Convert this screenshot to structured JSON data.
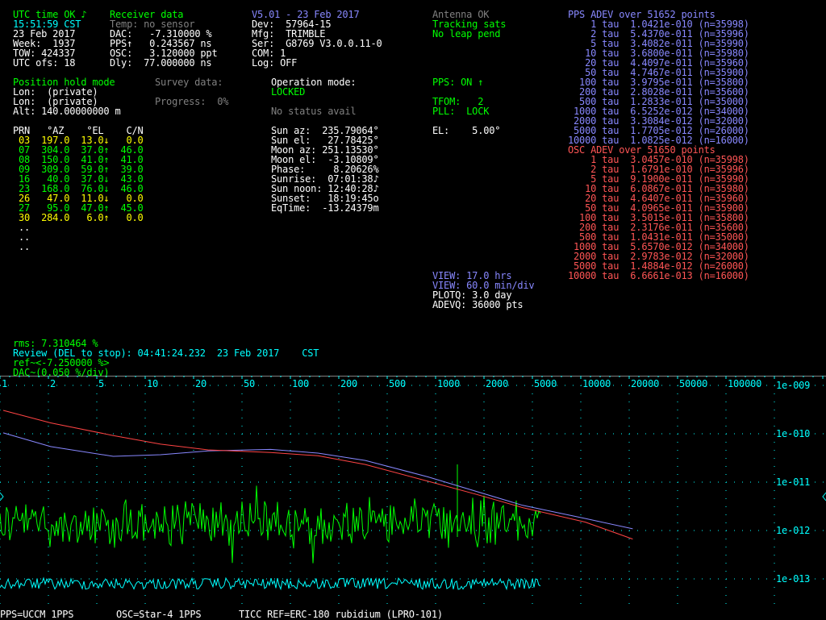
{
  "receiver": {
    "utc_status": "UTC time OK ♪",
    "time": "15:51:59 CST",
    "date": "23 Feb 2017",
    "week": "Week:  1937",
    "tow": "TOW: 424337",
    "utc_ofs": "UTC ofs: 18",
    "title": "Receiver data",
    "temp": "Temp: no sensor",
    "dac": "DAC:   -7.310000 %",
    "pps": "PPS↑   0.243567 ns",
    "osc": "OSC:   3.120000 ppt",
    "dly": "Dly:  77.000000 ns"
  },
  "device": {
    "version": "V5.01 - 23 Feb 2017",
    "dev": "Dev:  57964-15",
    "mfg": "Mfg:  TRIMBLE",
    "ser": "Ser:  G8769 V3.0.0.11-0",
    "com": "COM: 1",
    "log": "Log: OFF"
  },
  "antenna": {
    "antenna": "Antenna OK",
    "tracking": "Tracking sats",
    "leap": "No leap pend"
  },
  "position": {
    "mode": "Position hold mode",
    "lat": "Lon:  (private)",
    "lon": "Lon:  (private)",
    "alt": "Alt: 140.00000000 m",
    "survey": "Survey data:",
    "progress": "Progress:  0%"
  },
  "operation": {
    "label": "Operation mode:",
    "mode": "LOCKED",
    "status": "No status avail"
  },
  "pps_status": {
    "pps": "PPS: ON ↑",
    "tfom": "TFOM:   2",
    "pll": "PLL:  LOCK",
    "el": "EL:    5.00°"
  },
  "sats": {
    "header": "PRN   °AZ    °EL    C/N",
    "rows": [
      {
        "text": " 03  197.0  13.0↓   0.0",
        "color": "#ffff00"
      },
      {
        "text": " 07  304.0  37.0↑  46.0",
        "color": "#00ff00"
      },
      {
        "text": " 08  150.0  41.0↑  41.0",
        "color": "#00ff00"
      },
      {
        "text": " 09  309.0  59.0↑  39.0",
        "color": "#00ff00"
      },
      {
        "text": " 16   40.0  37.0↓  43.0",
        "color": "#00ff00"
      },
      {
        "text": " 23  168.0  76.0↓  46.0",
        "color": "#00ff00"
      },
      {
        "text": " 26   47.0  11.0↓   0.0",
        "color": "#ffff00"
      },
      {
        "text": " 27   95.0  47.0↑  45.0",
        "color": "#00ff00"
      },
      {
        "text": " 30  284.0   6.0↑   0.0",
        "color": "#ffff00"
      },
      {
        "text": " ..",
        "color": "#ffffff"
      },
      {
        "text": " ..",
        "color": "#ffffff"
      },
      {
        "text": " ..",
        "color": "#ffffff"
      }
    ]
  },
  "sun": [
    "Sun az:  235.79064°",
    "Sun el:   27.78425°",
    "Moon az: 251.13530°",
    "Moon el:  -3.10809°",
    "Phase:     8.20626%",
    "Sunrise:  07:01:38♪",
    "Sun noon: 12:40:28♪",
    "Sunset:   18:19:45o",
    "EqTime:  -13.24379m"
  ],
  "view": {
    "view1": "VIEW: 17.0 hrs",
    "view2": "VIEW: 60.0 min/div",
    "plotq": "PLOTQ: 3.0 day",
    "adevq": "ADEVQ: 36000 pts"
  },
  "pps_adev": {
    "title": "PPS ADEV over 51652 points",
    "rows": [
      "    1 tau  1.0421e-010 (n=35998)",
      "    2 tau  5.4370e-011 (n=35996)",
      "    5 tau  3.4082e-011 (n=35990)",
      "   10 tau  3.6800e-011 (n=35980)",
      "   20 tau  4.4097e-011 (n=35960)",
      "   50 tau  4.7467e-011 (n=35900)",
      "  100 tau  3.9795e-011 (n=35800)",
      "  200 tau  2.8028e-011 (n=35600)",
      "  500 tau  1.2833e-011 (n=35000)",
      " 1000 tau  6.5252e-012 (n=34000)",
      " 2000 tau  3.3084e-012 (n=32000)",
      " 5000 tau  1.7705e-012 (n=26000)",
      "10000 tau  1.0825e-012 (n=16000)"
    ]
  },
  "osc_adev": {
    "title": "OSC ADEV over 51650 points",
    "rows": [
      "    1 tau  3.0457e-010 (n=35998)",
      "    2 tau  1.6791e-010 (n=35996)",
      "    5 tau  9.1900e-011 (n=35990)",
      "   10 tau  6.0867e-011 (n=35980)",
      "   20 tau  4.6407e-011 (n=35960)",
      "   50 tau  4.0965e-011 (n=35900)",
      "  100 tau  3.5015e-011 (n=35800)",
      "  200 tau  2.3176e-011 (n=35600)",
      "  500 tau  1.0431e-011 (n=35000)",
      " 1000 tau  5.6570e-012 (n=34000)",
      " 2000 tau  2.9783e-012 (n=32000)",
      " 5000 tau  1.4884e-012 (n=26000)",
      "10000 tau  6.6661e-013 (n=16000)"
    ]
  },
  "review": {
    "rms": "rms: 7.310464 %",
    "review": "Review (DEL to stop): 04:41:24.232  23 Feb 2017    CST",
    "ref": "ref~<-7.250000 %>",
    "dac": "DAC~(0.050 %/div)"
  },
  "footer": {
    "pps": "PPS=UCCM 1PPS",
    "osc": "OSC=Star-4 1PPS",
    "ticc": "TICC REF=ERC-180 rubidium (LPRO-101)"
  },
  "chart_data": {
    "type": "line",
    "x_scale": "log",
    "y_scale": "log",
    "x_tick_labels": [
      "1",
      "2",
      "5",
      "10",
      "20",
      "50",
      "100",
      "200",
      "500",
      "1000",
      "2000",
      "5000",
      "10000",
      "20000",
      "50000",
      "100000"
    ],
    "y_tick_labels": [
      "1e-009",
      "1e-010",
      "1e-011",
      "1e-012",
      "1e-013"
    ],
    "grid": true,
    "colors": {
      "grid": "#00ffff",
      "pps": "#8888ff",
      "osc": "#ff4444",
      "dac": "#00ff00",
      "pps_trace": "#00ffff"
    },
    "series": [
      {
        "tau": [
          1,
          2,
          5,
          10,
          20,
          50,
          100,
          200,
          500,
          1000,
          2000,
          5000,
          10000
        ],
        "adev": [
          1.0421e-10,
          5.437e-11,
          3.4082e-11,
          3.68e-11,
          4.4097e-11,
          4.7467e-11,
          3.9795e-11,
          2.8028e-11,
          1.2833e-11,
          6.5252e-12,
          3.3084e-12,
          1.7705e-12,
          1.0825e-12
        ]
      },
      {
        "tau": [
          1,
          2,
          5,
          10,
          20,
          50,
          100,
          200,
          500,
          1000,
          2000,
          5000,
          10000
        ],
        "adev": [
          3.0457e-10,
          1.6791e-10,
          9.19e-11,
          6.0867e-11,
          4.6407e-11,
          4.0965e-11,
          3.5015e-11,
          2.3176e-11,
          1.0431e-11,
          5.657e-12,
          2.9783e-12,
          1.4884e-12,
          6.6661e-13
        ]
      }
    ]
  }
}
